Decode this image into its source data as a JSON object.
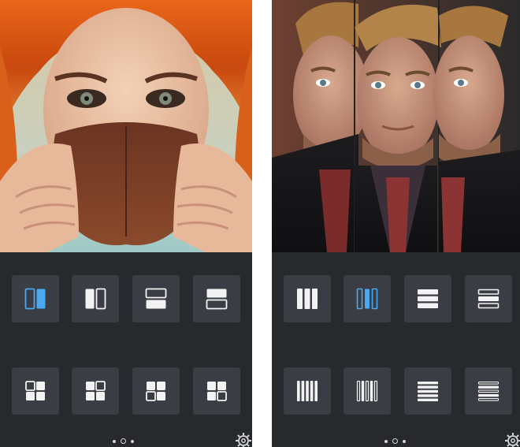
{
  "screens": [
    {
      "name": "mirror",
      "selected_layout": 0,
      "layouts": [
        {
          "icon": "mirror-vertical-left-icon"
        },
        {
          "icon": "mirror-vertical-right-icon"
        },
        {
          "icon": "mirror-horizontal-top-icon"
        },
        {
          "icon": "mirror-horizontal-bottom-icon"
        },
        {
          "icon": "mirror-quad-icon"
        },
        {
          "icon": "mirror-quad-variant-icon"
        },
        {
          "icon": "mirror-quad-alt-icon"
        },
        {
          "icon": "mirror-quad-corner-icon"
        }
      ],
      "page_indicator": {
        "count": 3,
        "active": 1
      }
    },
    {
      "name": "strips",
      "selected_layout": 1,
      "layouts": [
        {
          "icon": "three-vertical-strips-icon"
        },
        {
          "icon": "three-vertical-strips-outline-icon"
        },
        {
          "icon": "three-horizontal-strips-icon"
        },
        {
          "icon": "three-horizontal-strips-outline-icon"
        },
        {
          "icon": "five-vertical-strips-icon"
        },
        {
          "icon": "five-vertical-strips-outline-icon"
        },
        {
          "icon": "five-horizontal-strips-icon"
        },
        {
          "icon": "five-horizontal-strips-outline-icon"
        }
      ],
      "page_indicator": {
        "count": 3,
        "active": 1
      }
    }
  ],
  "colors": {
    "panel_bg": "#27292d",
    "tile_bg": "#3a3d43",
    "icon_white": "#f2f2f2",
    "icon_selected": "#4aa8f0"
  }
}
